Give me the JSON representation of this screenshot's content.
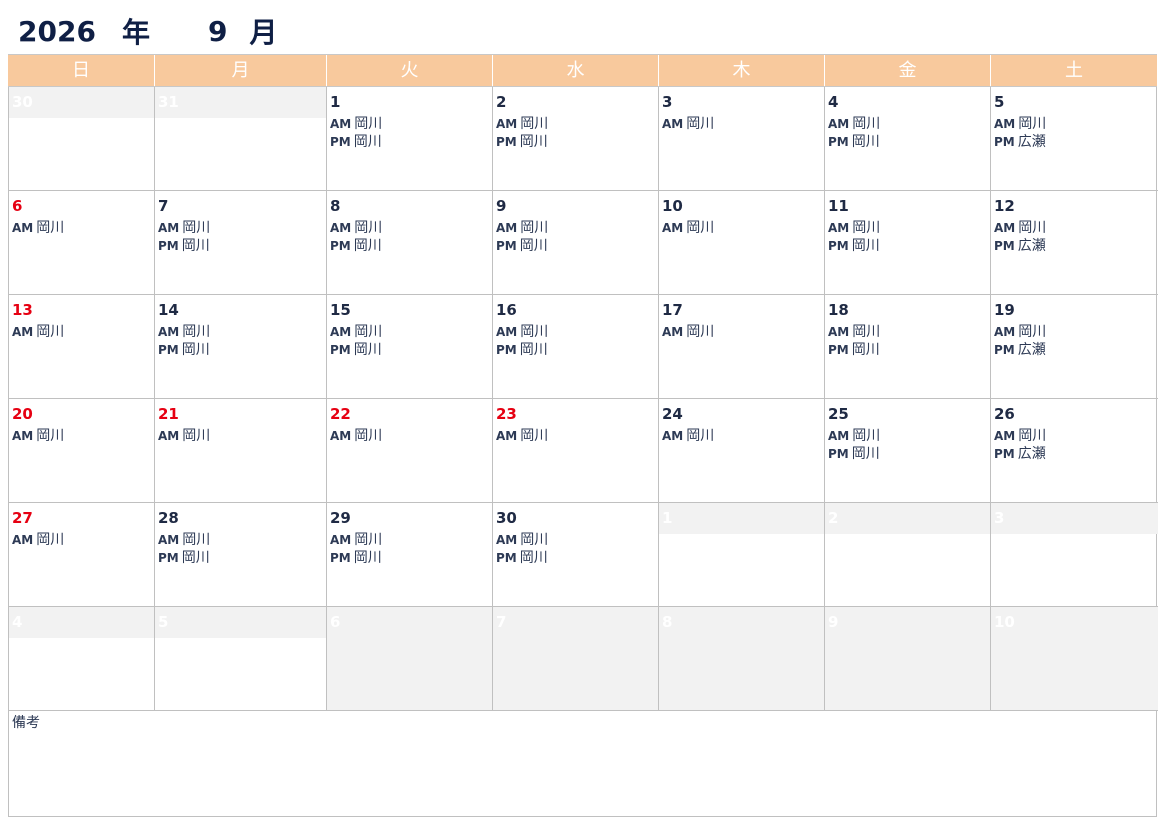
{
  "title": {
    "year": "2026",
    "year_kanji": "年",
    "month": "9",
    "month_kanji": "月"
  },
  "weekdays": [
    "日",
    "月",
    "火",
    "水",
    "木",
    "金",
    "土"
  ],
  "colors": {
    "header_bg": "#f8c99d",
    "sunday_red": "#e60012",
    "out_of_month_bg": "#f2f2f2"
  },
  "weeks": [
    [
      {
        "day": "30",
        "out": true,
        "entries": []
      },
      {
        "day": "31",
        "out": true,
        "entries": []
      },
      {
        "day": "1",
        "entries": [
          {
            "tag": "AM",
            "name": "岡川"
          },
          {
            "tag": "PM",
            "name": "岡川"
          }
        ]
      },
      {
        "day": "2",
        "entries": [
          {
            "tag": "AM",
            "name": "岡川"
          },
          {
            "tag": "PM",
            "name": "岡川"
          }
        ]
      },
      {
        "day": "3",
        "entries": [
          {
            "tag": "AM",
            "name": "岡川"
          }
        ]
      },
      {
        "day": "4",
        "entries": [
          {
            "tag": "AM",
            "name": "岡川"
          },
          {
            "tag": "PM",
            "name": "岡川"
          }
        ]
      },
      {
        "day": "5",
        "entries": [
          {
            "tag": "AM",
            "name": "岡川"
          },
          {
            "tag": "PM",
            "name": "広瀬"
          }
        ]
      }
    ],
    [
      {
        "day": "6",
        "red": true,
        "entries": [
          {
            "tag": "AM",
            "name": "岡川"
          }
        ]
      },
      {
        "day": "7",
        "entries": [
          {
            "tag": "AM",
            "name": "岡川"
          },
          {
            "tag": "PM",
            "name": "岡川"
          }
        ]
      },
      {
        "day": "8",
        "entries": [
          {
            "tag": "AM",
            "name": "岡川"
          },
          {
            "tag": "PM",
            "name": "岡川"
          }
        ]
      },
      {
        "day": "9",
        "entries": [
          {
            "tag": "AM",
            "name": "岡川"
          },
          {
            "tag": "PM",
            "name": "岡川"
          }
        ]
      },
      {
        "day": "10",
        "entries": [
          {
            "tag": "AM",
            "name": "岡川"
          }
        ]
      },
      {
        "day": "11",
        "entries": [
          {
            "tag": "AM",
            "name": "岡川"
          },
          {
            "tag": "PM",
            "name": "岡川"
          }
        ]
      },
      {
        "day": "12",
        "entries": [
          {
            "tag": "AM",
            "name": "岡川"
          },
          {
            "tag": "PM",
            "name": "広瀬"
          }
        ]
      }
    ],
    [
      {
        "day": "13",
        "red": true,
        "entries": [
          {
            "tag": "AM",
            "name": "岡川"
          }
        ]
      },
      {
        "day": "14",
        "entries": [
          {
            "tag": "AM",
            "name": "岡川"
          },
          {
            "tag": "PM",
            "name": "岡川"
          }
        ]
      },
      {
        "day": "15",
        "entries": [
          {
            "tag": "AM",
            "name": "岡川"
          },
          {
            "tag": "PM",
            "name": "岡川"
          }
        ]
      },
      {
        "day": "16",
        "entries": [
          {
            "tag": "AM",
            "name": "岡川"
          },
          {
            "tag": "PM",
            "name": "岡川"
          }
        ]
      },
      {
        "day": "17",
        "entries": [
          {
            "tag": "AM",
            "name": "岡川"
          }
        ]
      },
      {
        "day": "18",
        "entries": [
          {
            "tag": "AM",
            "name": "岡川"
          },
          {
            "tag": "PM",
            "name": "岡川"
          }
        ]
      },
      {
        "day": "19",
        "entries": [
          {
            "tag": "AM",
            "name": "岡川"
          },
          {
            "tag": "PM",
            "name": "広瀬"
          }
        ]
      }
    ],
    [
      {
        "day": "20",
        "red": true,
        "entries": [
          {
            "tag": "AM",
            "name": "岡川"
          }
        ]
      },
      {
        "day": "21",
        "red": true,
        "entries": [
          {
            "tag": "AM",
            "name": "岡川"
          }
        ]
      },
      {
        "day": "22",
        "red": true,
        "entries": [
          {
            "tag": "AM",
            "name": "岡川"
          }
        ]
      },
      {
        "day": "23",
        "red": true,
        "entries": [
          {
            "tag": "AM",
            "name": "岡川"
          }
        ]
      },
      {
        "day": "24",
        "entries": [
          {
            "tag": "AM",
            "name": "岡川"
          }
        ]
      },
      {
        "day": "25",
        "entries": [
          {
            "tag": "AM",
            "name": "岡川"
          },
          {
            "tag": "PM",
            "name": "岡川"
          }
        ]
      },
      {
        "day": "26",
        "entries": [
          {
            "tag": "AM",
            "name": "岡川"
          },
          {
            "tag": "PM",
            "name": "広瀬"
          }
        ]
      }
    ],
    [
      {
        "day": "27",
        "red": true,
        "entries": [
          {
            "tag": "AM",
            "name": "岡川"
          }
        ]
      },
      {
        "day": "28",
        "entries": [
          {
            "tag": "AM",
            "name": "岡川"
          },
          {
            "tag": "PM",
            "name": "岡川"
          }
        ]
      },
      {
        "day": "29",
        "entries": [
          {
            "tag": "AM",
            "name": "岡川"
          },
          {
            "tag": "PM",
            "name": "岡川"
          }
        ]
      },
      {
        "day": "30",
        "entries": [
          {
            "tag": "AM",
            "name": "岡川"
          },
          {
            "tag": "PM",
            "name": "岡川"
          }
        ]
      },
      {
        "day": "1",
        "out": true,
        "entries": []
      },
      {
        "day": "2",
        "out": true,
        "entries": []
      },
      {
        "day": "3",
        "out": true,
        "entries": []
      }
    ],
    [
      {
        "day": "4",
        "out": true,
        "entries": []
      },
      {
        "day": "5",
        "out": true,
        "entries": []
      },
      {
        "day": "6",
        "out": true,
        "full": true,
        "entries": []
      },
      {
        "day": "7",
        "out": true,
        "full": true,
        "entries": []
      },
      {
        "day": "8",
        "out": true,
        "full": true,
        "entries": []
      },
      {
        "day": "9",
        "out": true,
        "full": true,
        "entries": []
      },
      {
        "day": "10",
        "out": true,
        "full": true,
        "entries": []
      }
    ]
  ],
  "notes": {
    "label": "備考"
  }
}
